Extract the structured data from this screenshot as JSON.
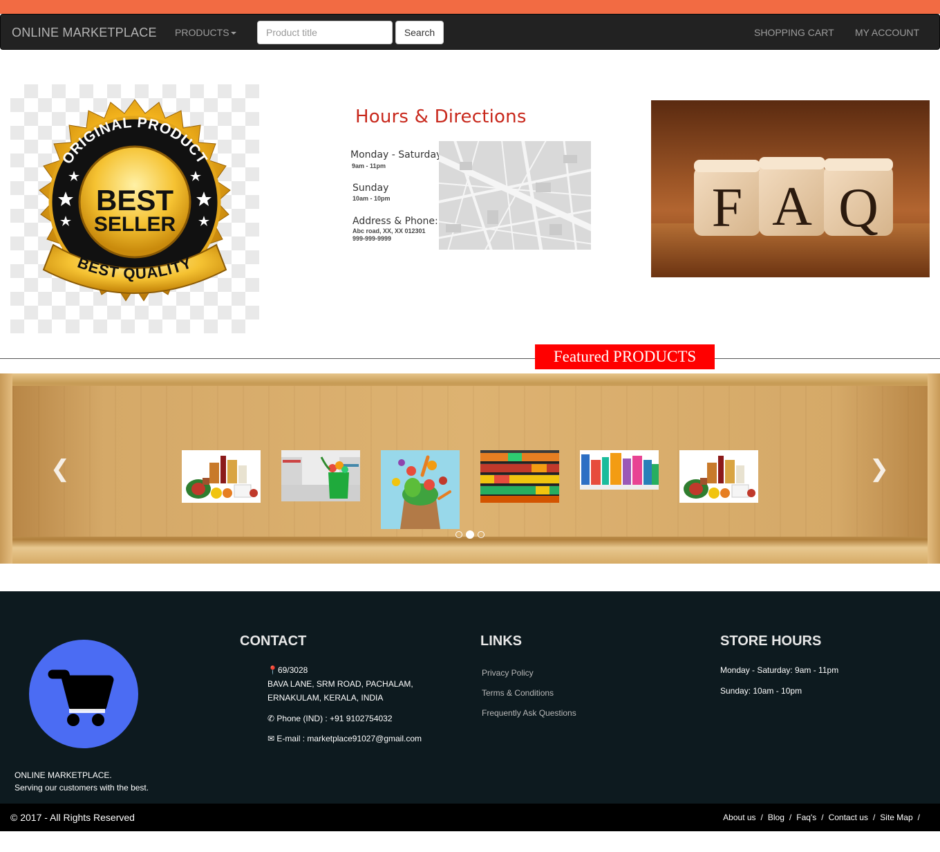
{
  "colors": {
    "top_strip": "#f26b43",
    "navbar": "#222222",
    "accent_red": "#c8281c",
    "featured_bg": "#ff0000",
    "footer_bg": "#0d1a1f",
    "cart_blue": "#4b6cf3"
  },
  "navbar": {
    "brand": "ONLINE MARKETPLACE",
    "products_label": "PRODUCTS",
    "search_placeholder": "Product title",
    "search_button": "Search",
    "cart_link": "SHOPPING CART",
    "account_link": "MY ACCOUNT"
  },
  "badge": {
    "top_text": "ORIGINAL PRODUCT",
    "line1": "BEST",
    "line2": "SELLER",
    "ribbon_text": "BEST QUALITY"
  },
  "hours": {
    "title": "Hours & Directions",
    "weekday_label": "Monday - Saturday",
    "weekday_time": "9am - 11pm",
    "sunday_label": "Sunday",
    "sunday_time": "10am - 10pm",
    "address_label": "Address & Phone:",
    "address_line": "Abc road, XX, XX 012301",
    "phone_line": "999-999-9999"
  },
  "faq": {
    "letters": [
      "F",
      "A",
      "Q"
    ]
  },
  "featured": {
    "label": "Featured PRODUCTS",
    "products": [
      {
        "icon": "grocery-assortment-image"
      },
      {
        "icon": "shopping-bag-supermarket-image"
      },
      {
        "icon": "vegetables-paper-bag-image"
      },
      {
        "icon": "produce-shelves-image"
      },
      {
        "icon": "household-products-image"
      },
      {
        "icon": "grocery-assortment-image"
      }
    ],
    "active_slide": 2,
    "slide_count": 3
  },
  "footer": {
    "brand_line1": "ONLINE MARKETPLACE.",
    "brand_line2": "Serving our customers with the best.",
    "contact": {
      "heading": "CONTACT",
      "addr1": "69/3028",
      "addr2": "BAVA LANE, SRM ROAD, PACHALAM,",
      "addr3": "ERNAKULAM, KERALA, INDIA",
      "phone": "Phone (IND) : +91 9102754032",
      "email": "E-mail : marketplace91027@gmail.com"
    },
    "links": {
      "heading": "LINKS",
      "items": [
        "Privacy Policy",
        "Terms & Conditions",
        "Frequently Ask Questions"
      ]
    },
    "store_hours": {
      "heading": "STORE HOURS",
      "weekdays": "Monday - Saturday: 9am - 11pm",
      "sunday": "Sunday: 10am - 10pm"
    }
  },
  "bottom": {
    "copyright": "© 2017 - All Rights Reserved",
    "links": [
      "About us",
      "Blog",
      "Faq's",
      "Contact us",
      "Site Map"
    ],
    "separator": "/"
  }
}
